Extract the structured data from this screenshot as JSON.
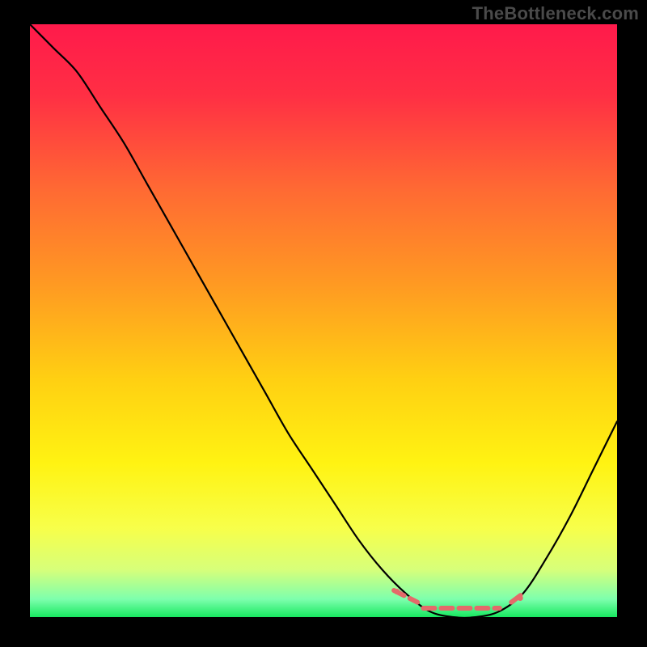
{
  "watermark": "TheBottleneck.com",
  "chart_data": {
    "type": "line",
    "title": "",
    "xlabel": "",
    "ylabel": "",
    "xlim": [
      0,
      100
    ],
    "ylim": [
      0,
      100
    ],
    "gradient_stops": [
      {
        "offset": 0.0,
        "color": "#ff1a4b"
      },
      {
        "offset": 0.12,
        "color": "#ff2f44"
      },
      {
        "offset": 0.28,
        "color": "#ff6a33"
      },
      {
        "offset": 0.44,
        "color": "#ff9a22"
      },
      {
        "offset": 0.6,
        "color": "#ffd012"
      },
      {
        "offset": 0.74,
        "color": "#fff312"
      },
      {
        "offset": 0.85,
        "color": "#f7ff4a"
      },
      {
        "offset": 0.92,
        "color": "#d7ff7a"
      },
      {
        "offset": 0.97,
        "color": "#7dffad"
      },
      {
        "offset": 1.0,
        "color": "#18e860"
      }
    ],
    "series": [
      {
        "name": "bottleneck-curve",
        "color": "#000000",
        "x": [
          0,
          4,
          8,
          12,
          16,
          20,
          24,
          28,
          32,
          36,
          40,
          44,
          48,
          52,
          56,
          60,
          64,
          68,
          72,
          76,
          80,
          84,
          88,
          92,
          96,
          100
        ],
        "y": [
          100,
          96,
          92,
          86,
          80,
          73,
          66,
          59,
          52,
          45,
          38,
          31,
          25,
          19,
          13,
          8,
          4,
          1,
          0,
          0,
          1,
          4,
          10,
          17,
          25,
          33
        ]
      }
    ],
    "accent": {
      "name": "optimal-range",
      "color": "#e46a6a",
      "segments": [
        {
          "x": [
            62,
            66
          ],
          "y": [
            4.5,
            2.5
          ]
        },
        {
          "x": [
            67,
            80
          ],
          "y": [
            1.5,
            1.5
          ]
        },
        {
          "x": [
            82,
            84
          ],
          "y": [
            2.5,
            4.0
          ]
        }
      ],
      "points": [
        {
          "x": 62.5,
          "y": 4.3
        },
        {
          "x": 83.5,
          "y": 3.2
        }
      ]
    }
  }
}
